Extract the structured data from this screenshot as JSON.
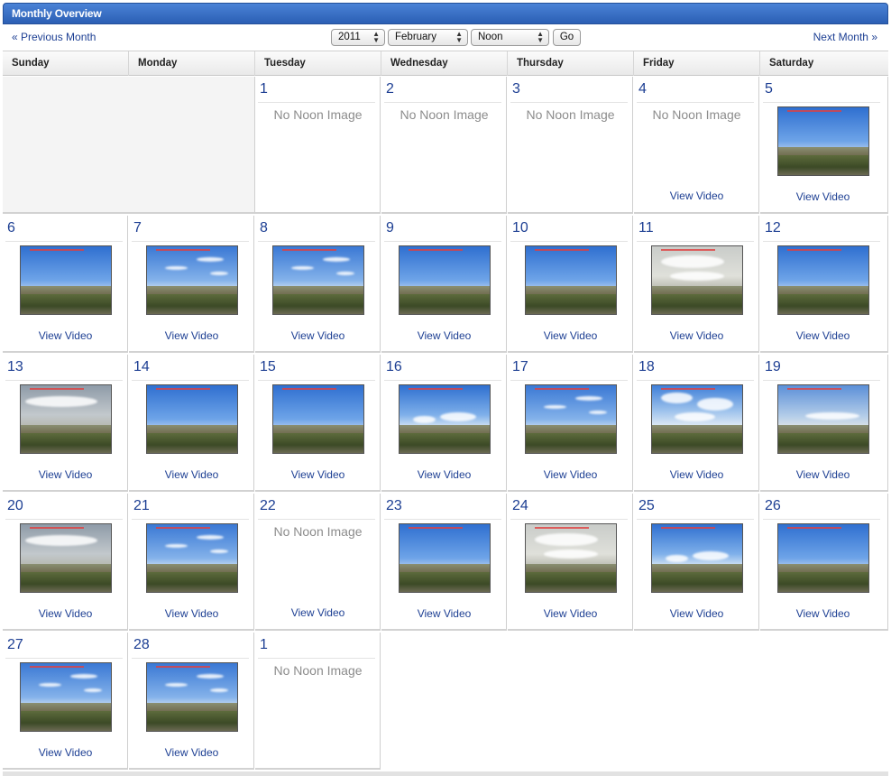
{
  "header": {
    "title": "Monthly Overview"
  },
  "nav": {
    "prev_label": "« Previous Month",
    "next_label": "Next Month »",
    "year": "2011",
    "month": "February",
    "time": "Noon",
    "go_label": "Go"
  },
  "weekdays": [
    "Sunday",
    "Monday",
    "Tuesday",
    "Wednesday",
    "Thursday",
    "Friday",
    "Saturday"
  ],
  "labels": {
    "no_image": "No Noon Image",
    "view_video": "View Video"
  },
  "colors": {
    "accent": "#2b5fb4",
    "link": "#1d3f93",
    "muted": "#8c8c8c"
  },
  "cells": [
    {
      "kind": "blank"
    },
    {
      "kind": "blank"
    },
    {
      "day": "1",
      "image": false,
      "video": false
    },
    {
      "day": "2",
      "image": false,
      "video": false
    },
    {
      "day": "3",
      "image": false,
      "video": false
    },
    {
      "day": "4",
      "image": false,
      "video": true
    },
    {
      "day": "5",
      "image": true,
      "video": true,
      "sky": "clear"
    },
    {
      "day": "6",
      "image": true,
      "video": true,
      "sky": "clear"
    },
    {
      "day": "7",
      "image": true,
      "video": true,
      "sky": "wispy"
    },
    {
      "day": "8",
      "image": true,
      "video": true,
      "sky": "wispy"
    },
    {
      "day": "9",
      "image": true,
      "video": true,
      "sky": "clear"
    },
    {
      "day": "10",
      "image": true,
      "video": true,
      "sky": "clear"
    },
    {
      "day": "11",
      "image": true,
      "video": true,
      "sky": "overcast"
    },
    {
      "day": "12",
      "image": true,
      "video": true,
      "sky": "clear"
    },
    {
      "day": "13",
      "image": true,
      "video": true,
      "sky": "grey"
    },
    {
      "day": "14",
      "image": true,
      "video": true,
      "sky": "clear"
    },
    {
      "day": "15",
      "image": true,
      "video": true,
      "sky": "clear"
    },
    {
      "day": "16",
      "image": true,
      "video": true,
      "sky": "cumulus"
    },
    {
      "day": "17",
      "image": true,
      "video": true,
      "sky": "wispy"
    },
    {
      "day": "18",
      "image": true,
      "video": true,
      "sky": "cumulus-heavy"
    },
    {
      "day": "19",
      "image": true,
      "video": true,
      "sky": "hazy"
    },
    {
      "day": "20",
      "image": true,
      "video": true,
      "sky": "grey"
    },
    {
      "day": "21",
      "image": true,
      "video": true,
      "sky": "wispy"
    },
    {
      "day": "22",
      "image": false,
      "video": true
    },
    {
      "day": "23",
      "image": true,
      "video": true,
      "sky": "clear"
    },
    {
      "day": "24",
      "image": true,
      "video": true,
      "sky": "overcast"
    },
    {
      "day": "25",
      "image": true,
      "video": true,
      "sky": "cumulus"
    },
    {
      "day": "26",
      "image": true,
      "video": true,
      "sky": "clear"
    },
    {
      "day": "27",
      "image": true,
      "video": true,
      "sky": "wispy"
    },
    {
      "day": "28",
      "image": true,
      "video": true,
      "sky": "wispy"
    },
    {
      "day": "1",
      "image": false,
      "video": false
    },
    {
      "kind": "empty"
    },
    {
      "kind": "empty"
    },
    {
      "kind": "empty"
    },
    {
      "kind": "empty"
    }
  ]
}
